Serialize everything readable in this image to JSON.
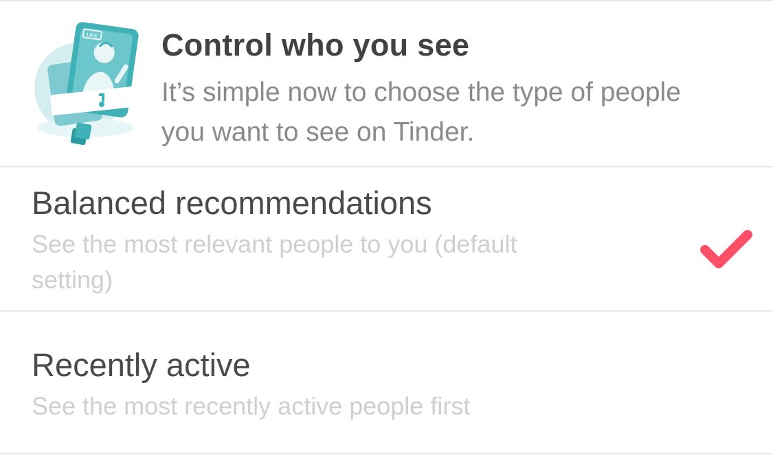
{
  "header": {
    "title": "Control who you see",
    "description": "It’s simple now to choose the type of people you want to see on Tinder.",
    "illustration_badge": "LIKE",
    "illustration_icon": "profile-card-illustration"
  },
  "options": [
    {
      "title": "Balanced recommendations",
      "subtitle": "See the most relevant people to you (default setting)",
      "selected": true
    },
    {
      "title": "Recently active",
      "subtitle": "See the most recently active people first",
      "selected": false
    }
  ],
  "colors": {
    "accent": "#fd5068",
    "illustration_teal": "#3fb1b7",
    "illustration_light": "#c9e8ea",
    "title_text": "#424242",
    "secondary_text": "#8a8a8a",
    "muted_text": "#cfcfcf",
    "divider": "#e9e9e9"
  },
  "icons": {
    "selected_indicator": "checkmark-icon"
  }
}
